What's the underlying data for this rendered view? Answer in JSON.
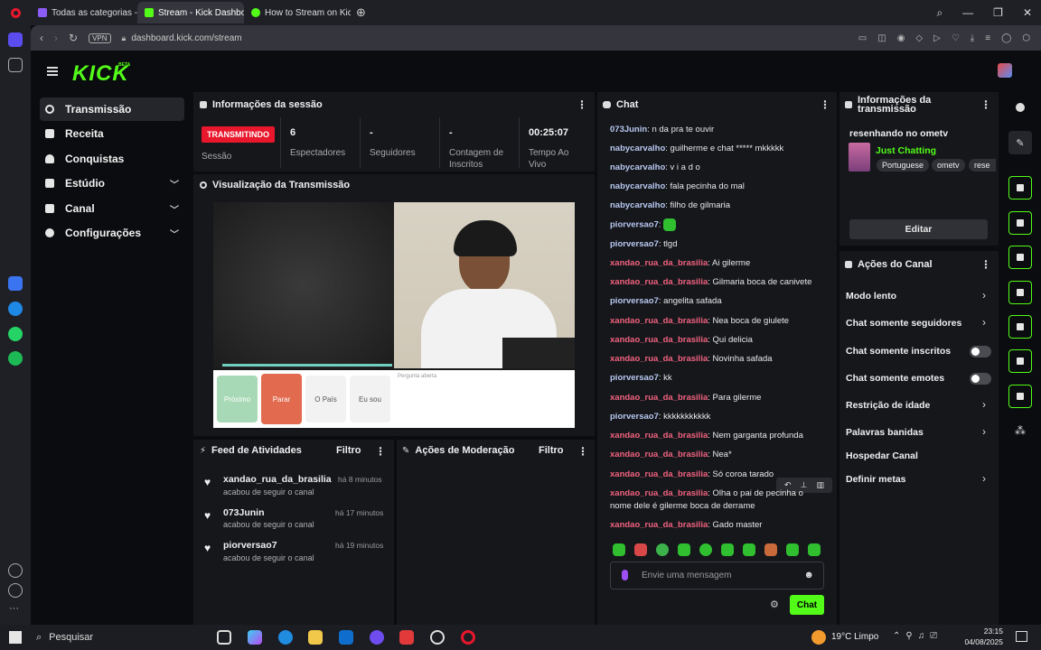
{
  "browser": {
    "tabs": [
      {
        "label": "Todas as categorias - Twit",
        "color": "#8b5cf6"
      },
      {
        "label": "Stream - Kick Dashboard",
        "color": "#53fc18"
      },
      {
        "label": "How to Stream on Kick.co",
        "color": "#53fc18"
      }
    ],
    "address": "dashboard.kick.com/stream",
    "vpn": "VPN"
  },
  "kick": {
    "logo": "KICK",
    "beta": "BETA"
  },
  "nav": [
    {
      "label": "Transmissão",
      "active": true
    },
    {
      "label": "Receita"
    },
    {
      "label": "Conquistas"
    },
    {
      "label": "Estúdio",
      "chevron": true
    },
    {
      "label": "Canal",
      "chevron": true
    },
    {
      "label": "Configurações",
      "chevron": true
    }
  ],
  "session": {
    "title": "Informações da sessão",
    "status": "TRANSMITINDO",
    "status_label": "Sessão",
    "stats": [
      {
        "value": "6",
        "label": "Espectadores"
      },
      {
        "value": "-",
        "label": "Seguidores"
      },
      {
        "value": "-",
        "label": "Contagem de Inscritos"
      },
      {
        "value": "00:25:07",
        "label": "Tempo Ao Vivo"
      }
    ]
  },
  "preview": {
    "title": "Visualização da Transmissão",
    "buttons": [
      "Próximo",
      "Parar",
      "O País",
      "Eu sou"
    ],
    "prompt": "Pergunta aberta"
  },
  "feed": {
    "title": "Feed de Atividades",
    "filter": "Filtro",
    "items": [
      {
        "name": "xandao_rua_da_brasilia",
        "sub": "acabou de seguir o canal",
        "time": "há 8 minutos"
      },
      {
        "name": "073Junin",
        "sub": "acabou de seguir o canal",
        "time": "há 17 minutos"
      },
      {
        "name": "piorversao7",
        "sub": "acabou de seguir o canal",
        "time": "há 19 minutos"
      }
    ]
  },
  "moderation": {
    "title": "Ações de Moderação",
    "filter": "Filtro"
  },
  "chat": {
    "title": "Chat",
    "messages": [
      {
        "user": "073Junin",
        "text": "n da pra te ouvir",
        "c": "u1"
      },
      {
        "user": "nabycarvalho",
        "text": "guilherme e chat ***** mkkkkk",
        "c": "u1"
      },
      {
        "user": "nabycarvalho",
        "text": "v i a d o",
        "c": "u1"
      },
      {
        "user": "nabycarvalho",
        "text": "fala pecinha do mal",
        "c": "u1"
      },
      {
        "user": "nabycarvalho",
        "text": "filho de gilmaria",
        "c": "u1"
      },
      {
        "user": "piorversao7",
        "text": "",
        "c": "u1"
      },
      {
        "user": "piorversao7",
        "text": "tlgd",
        "c": "u1"
      },
      {
        "user": "xandao_rua_da_brasilia",
        "text": "Ai gilerme",
        "c": "u2"
      },
      {
        "user": "xandao_rua_da_brasilia",
        "text": "Gilmaria boca de canivete",
        "c": "u2"
      },
      {
        "user": "piorversao7",
        "text": "angelita safada",
        "c": "u1"
      },
      {
        "user": "xandao_rua_da_brasilia",
        "text": "Nea boca de giulete",
        "c": "u2"
      },
      {
        "user": "xandao_rua_da_brasilia",
        "text": "Qui delicia",
        "c": "u2"
      },
      {
        "user": "xandao_rua_da_brasilia",
        "text": "Novinha safada",
        "c": "u2"
      },
      {
        "user": "piorversao7",
        "text": "kk",
        "c": "u1"
      },
      {
        "user": "xandao_rua_da_brasilia",
        "text": "Para gilerme",
        "c": "u2"
      },
      {
        "user": "piorversao7",
        "text": "kkkkkkkkkkk",
        "c": "u1"
      },
      {
        "user": "xandao_rua_da_brasilia",
        "text": "Nem garganta profunda",
        "c": "u2"
      },
      {
        "user": "xandao_rua_da_brasilia",
        "text": "Nea*",
        "c": "u2"
      },
      {
        "user": "xandao_rua_da_brasilia",
        "text": "Só coroa tarado",
        "c": "u2"
      },
      {
        "user": "xandao_rua_da_brasilia",
        "text": "Olha o pai de pecinha o nome dele é gilerme boca de derrame",
        "c": "u2"
      },
      {
        "user": "xandao_rua_da_brasilia",
        "text": "Gado master",
        "c": "u2"
      }
    ],
    "placeholder": "Envie uma mensagem",
    "send": "Chat"
  },
  "stream_info": {
    "title": "Informações da transmissão",
    "stream_title": "resenhando no ometv",
    "category": "Just Chatting",
    "tags": [
      "Portuguese",
      "ometv",
      "rese"
    ],
    "edit": "Editar"
  },
  "channel_actions": {
    "title": "Ações do Canal",
    "items": [
      {
        "label": "Modo lento",
        "kind": "chevron"
      },
      {
        "label": "Chat somente seguidores",
        "kind": "chevron"
      },
      {
        "label": "Chat somente inscritos",
        "kind": "toggle"
      },
      {
        "label": "Chat somente emotes",
        "kind": "toggle"
      },
      {
        "label": "Restrição de idade",
        "kind": "chevron"
      },
      {
        "label": "Palavras banidas",
        "kind": "chevron"
      },
      {
        "label": "Hospedar Canal",
        "kind": "none"
      },
      {
        "label": "Definir metas",
        "kind": "chevron"
      }
    ]
  },
  "taskbar": {
    "search": "Pesquisar",
    "weather": "19°C  Limpo",
    "time": "23:15",
    "date": "04/08/2025"
  },
  "colors": {
    "accent": "#53fc18",
    "live": "#e8172c"
  }
}
